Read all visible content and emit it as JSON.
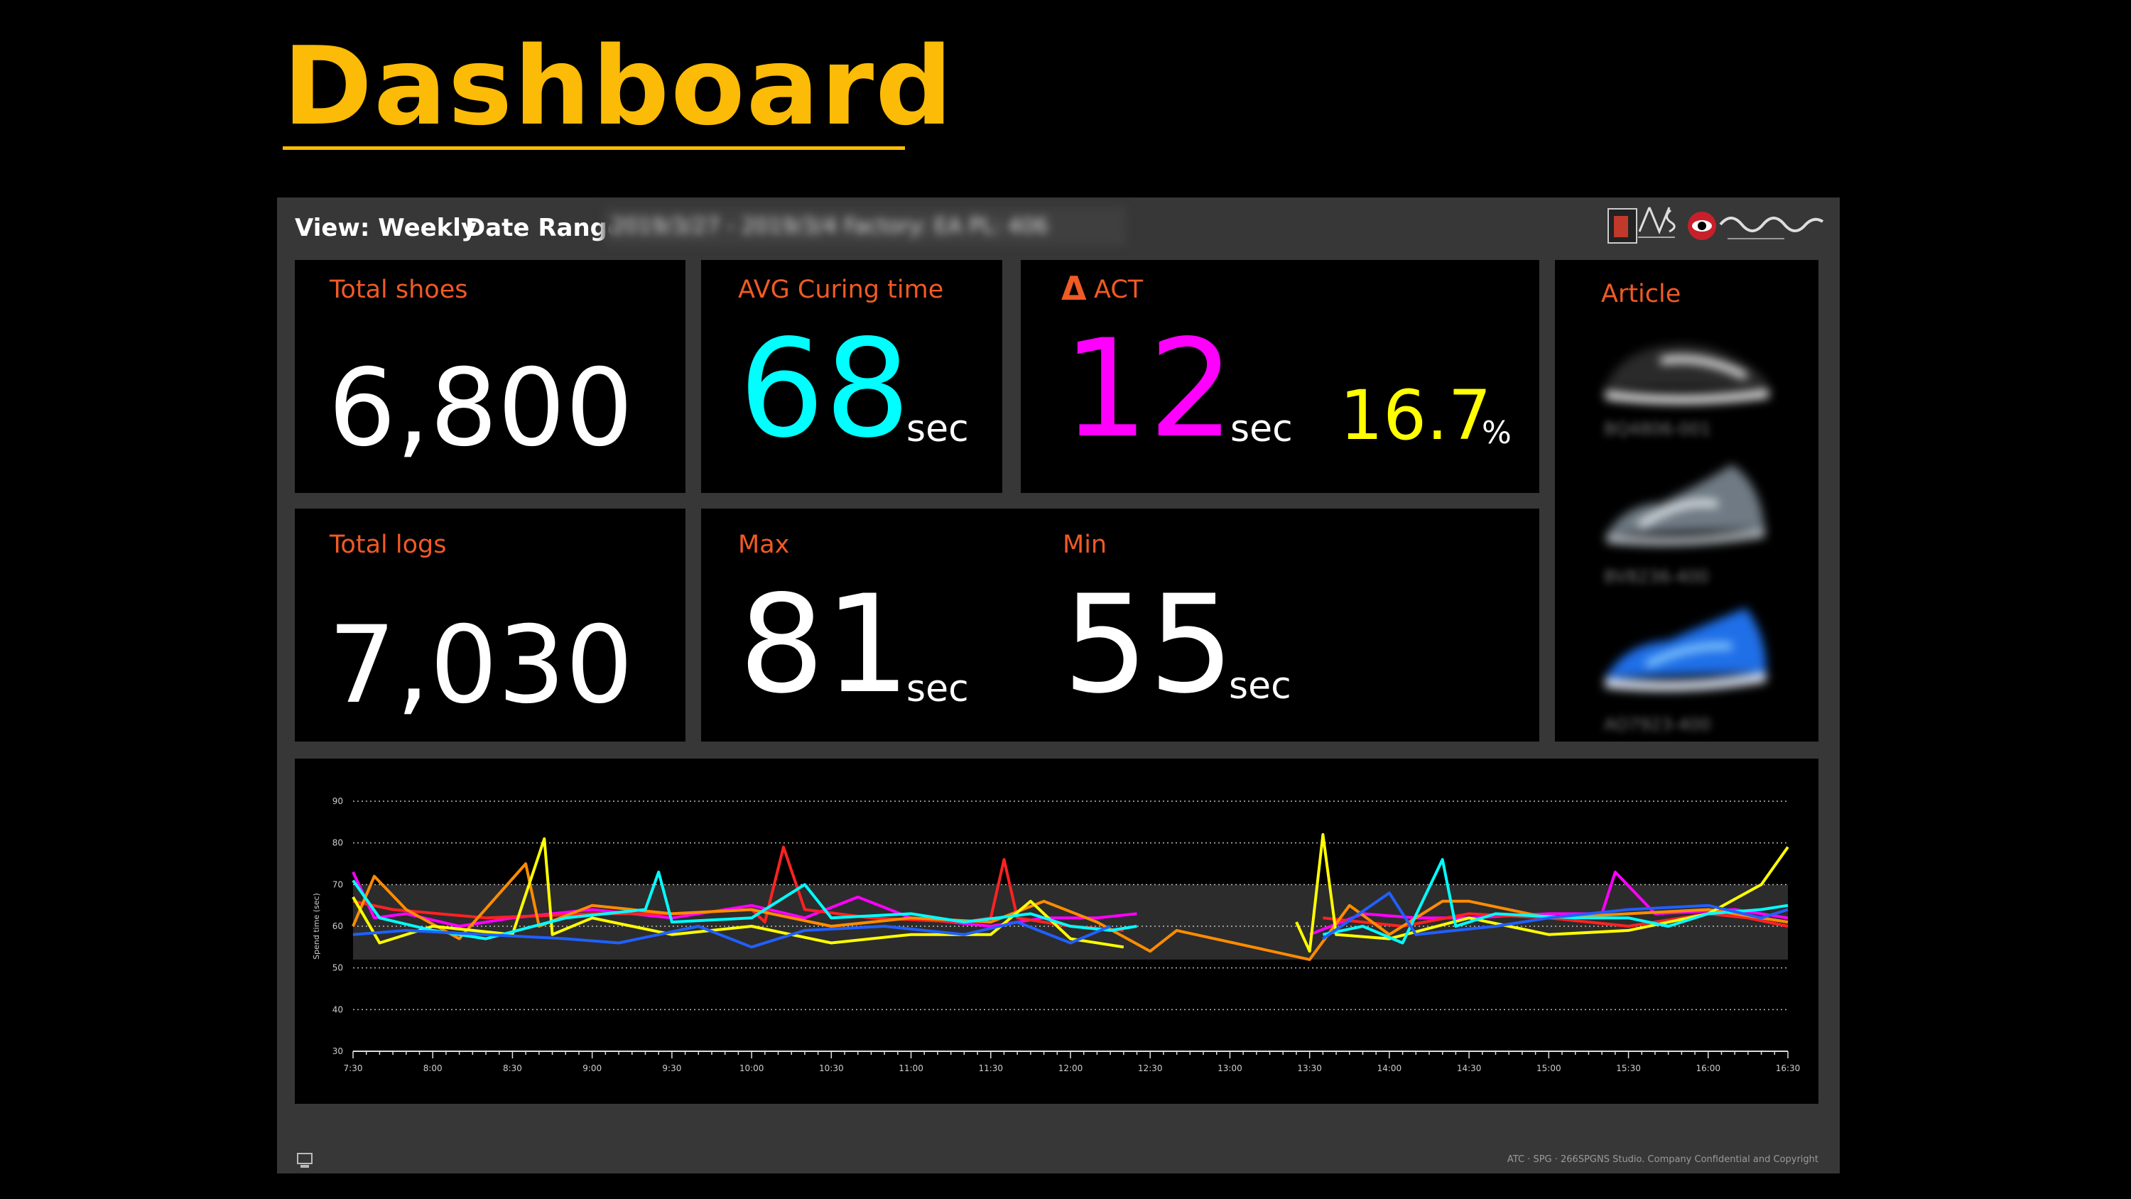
{
  "page_title": "Dashboard",
  "topbar": {
    "view_text": "View: Weekly",
    "date_range_label": "Date Range:",
    "date_range_value": "2019/3/27 - 2019/3/4   Factory: EA   PL: 406"
  },
  "cards": {
    "total_shoes": {
      "label": "Total shoes",
      "value": "6,800"
    },
    "avg_curing": {
      "label": "AVG Curing time",
      "value": "68",
      "unit": "sec"
    },
    "delta_act": {
      "label": "ACT",
      "delta_symbol": "Δ",
      "value": "12",
      "unit": "sec",
      "percent_value": "16.7",
      "percent_unit": "%"
    },
    "total_logs": {
      "label": "Total logs",
      "value": "7,030"
    },
    "max": {
      "label": "Max",
      "value": "81",
      "unit": "sec"
    },
    "min": {
      "label": "Min",
      "value": "55",
      "unit": "sec"
    },
    "article": {
      "label": "Article",
      "items": [
        {
          "name": "BQ4806-001",
          "color": "#e8e8e8"
        },
        {
          "name": "BV8236-400",
          "color": "#9aa3ad"
        },
        {
          "name": "AO7923-400",
          "color": "#1f6fe8"
        }
      ]
    }
  },
  "colors": {
    "title": "#fbbb06",
    "label": "#f05a24",
    "avg_value": "#00ffff",
    "act_value": "#ff00ff",
    "percent_value": "#ffff00"
  },
  "chart_data": {
    "type": "line",
    "ylabel": "Spend time (sec)",
    "ylim": [
      30,
      90
    ],
    "yticks": [
      30,
      40,
      50,
      60,
      70,
      80,
      90
    ],
    "xlim": [
      "7:30",
      "16:30"
    ],
    "xticks": [
      "7:30",
      "8:00",
      "8:30",
      "9:00",
      "9:30",
      "10:00",
      "10:30",
      "11:00",
      "11:30",
      "12:00",
      "12:30",
      "13:00",
      "13:30",
      "14:00",
      "14:30",
      "15:00",
      "15:30",
      "16:00",
      "16:30"
    ],
    "band": [
      52,
      70
    ],
    "grid": "dotted",
    "series": [
      {
        "color": "#ff00ff",
        "points": [
          [
            "7:30",
            73
          ],
          [
            "7:38",
            62
          ],
          [
            "7:50",
            63
          ],
          [
            "8:10",
            60
          ],
          [
            "8:30",
            62
          ],
          [
            "9:00",
            64
          ],
          [
            "9:30",
            62
          ],
          [
            "10:00",
            65
          ],
          [
            "10:20",
            62
          ],
          [
            "10:40",
            67
          ],
          [
            "11:00",
            62
          ],
          [
            "11:30",
            60
          ],
          [
            "11:50",
            62
          ],
          [
            "12:10",
            62
          ],
          [
            "12:25",
            63
          ],
          [
            "13:30",
            58
          ],
          [
            "13:50",
            63
          ],
          [
            "14:10",
            62
          ],
          [
            "14:30",
            62
          ],
          [
            "15:00",
            63
          ],
          [
            "15:20",
            63
          ],
          [
            "15:25",
            73
          ],
          [
            "15:40",
            63
          ],
          [
            "16:10",
            64
          ],
          [
            "16:30",
            62
          ]
        ]
      },
      {
        "color": "#ff2222",
        "points": [
          [
            "7:30",
            66
          ],
          [
            "7:45",
            64
          ],
          [
            "8:20",
            62
          ],
          [
            "9:00",
            63
          ],
          [
            "9:30",
            63
          ],
          [
            "10:00",
            64
          ],
          [
            "10:05",
            61
          ],
          [
            "10:12",
            79
          ],
          [
            "10:20",
            64
          ],
          [
            "10:45",
            62
          ],
          [
            "11:20",
            61
          ],
          [
            "11:30",
            62
          ],
          [
            "11:35",
            76
          ],
          [
            "11:40",
            62
          ],
          [
            "12:00",
            60
          ],
          [
            "12:20",
            59
          ],
          [
            "13:35",
            62
          ],
          [
            "14:05",
            60
          ],
          [
            "14:30",
            63
          ],
          [
            "15:00",
            62
          ],
          [
            "15:30",
            60
          ],
          [
            "16:00",
            63
          ],
          [
            "16:15",
            62
          ],
          [
            "16:30",
            60
          ]
        ]
      },
      {
        "color": "#ff8c00",
        "points": [
          [
            "7:30",
            60
          ],
          [
            "7:38",
            72
          ],
          [
            "7:50",
            64
          ],
          [
            "8:10",
            57
          ],
          [
            "8:35",
            75
          ],
          [
            "8:40",
            60
          ],
          [
            "9:00",
            65
          ],
          [
            "9:30",
            63
          ],
          [
            "10:00",
            64
          ],
          [
            "10:30",
            60
          ],
          [
            "11:00",
            62
          ],
          [
            "11:30",
            61
          ],
          [
            "11:50",
            66
          ],
          [
            "12:10",
            61
          ],
          [
            "12:30",
            54
          ],
          [
            "12:40",
            59
          ],
          [
            "13:30",
            52
          ],
          [
            "13:45",
            65
          ],
          [
            "14:00",
            58
          ],
          [
            "14:20",
            66
          ],
          [
            "14:30",
            66
          ],
          [
            "15:00",
            62
          ],
          [
            "15:30",
            63
          ],
          [
            "16:00",
            64
          ],
          [
            "16:30",
            61
          ]
        ]
      },
      {
        "color": "#ffff00",
        "points": [
          [
            "7:30",
            67
          ],
          [
            "7:40",
            56
          ],
          [
            "8:00",
            60
          ],
          [
            "8:30",
            58
          ],
          [
            "8:42",
            81
          ],
          [
            "8:45",
            58
          ],
          [
            "9:00",
            62
          ],
          [
            "9:30",
            58
          ],
          [
            "10:00",
            60
          ],
          [
            "10:30",
            56
          ],
          [
            "11:00",
            58
          ],
          [
            "11:30",
            58
          ],
          [
            "11:45",
            66
          ],
          [
            "12:00",
            57
          ],
          [
            "12:20",
            55
          ],
          [
            "13:25",
            61
          ],
          [
            "13:30",
            54
          ],
          [
            "13:35",
            82
          ],
          [
            "13:40",
            58
          ],
          [
            "14:00",
            57
          ],
          [
            "14:30",
            62
          ],
          [
            "15:00",
            58
          ],
          [
            "15:30",
            59
          ],
          [
            "16:00",
            63
          ],
          [
            "16:20",
            70
          ],
          [
            "16:30",
            79
          ]
        ]
      },
      {
        "color": "#00ffff",
        "points": [
          [
            "7:30",
            71
          ],
          [
            "7:40",
            62
          ],
          [
            "8:00",
            59
          ],
          [
            "8:20",
            57
          ],
          [
            "8:50",
            62
          ],
          [
            "9:20",
            64
          ],
          [
            "9:25",
            73
          ],
          [
            "9:30",
            61
          ],
          [
            "10:00",
            62
          ],
          [
            "10:20",
            70
          ],
          [
            "10:30",
            62
          ],
          [
            "11:00",
            63
          ],
          [
            "11:20",
            61
          ],
          [
            "11:45",
            63
          ],
          [
            "12:00",
            60
          ],
          [
            "12:15",
            59
          ],
          [
            "12:25",
            60
          ],
          [
            "13:35",
            58
          ],
          [
            "13:50",
            60
          ],
          [
            "14:05",
            56
          ],
          [
            "14:20",
            76
          ],
          [
            "14:25",
            60
          ],
          [
            "14:40",
            63
          ],
          [
            "15:10",
            62
          ],
          [
            "15:30",
            62
          ],
          [
            "15:45",
            60
          ],
          [
            "16:00",
            63
          ],
          [
            "16:20",
            64
          ],
          [
            "16:30",
            65
          ]
        ]
      },
      {
        "color": "#2060ff",
        "points": [
          [
            "7:30",
            58
          ],
          [
            "7:50",
            59
          ],
          [
            "8:20",
            58
          ],
          [
            "8:50",
            57
          ],
          [
            "9:10",
            56
          ],
          [
            "9:40",
            60
          ],
          [
            "10:00",
            55
          ],
          [
            "10:20",
            59
          ],
          [
            "10:50",
            60
          ],
          [
            "11:20",
            58
          ],
          [
            "11:40",
            61
          ],
          [
            "12:00",
            56
          ],
          [
            "12:15",
            60
          ],
          [
            "13:35",
            57
          ],
          [
            "14:00",
            68
          ],
          [
            "14:10",
            58
          ],
          [
            "14:40",
            60
          ],
          [
            "15:00",
            62
          ],
          [
            "15:30",
            64
          ],
          [
            "16:00",
            65
          ],
          [
            "16:20",
            62
          ],
          [
            "16:30",
            64
          ]
        ]
      }
    ]
  },
  "footer": {
    "text": "ATC · SPG · 266SPGNS Studio. Company Confidential and Copyright"
  }
}
